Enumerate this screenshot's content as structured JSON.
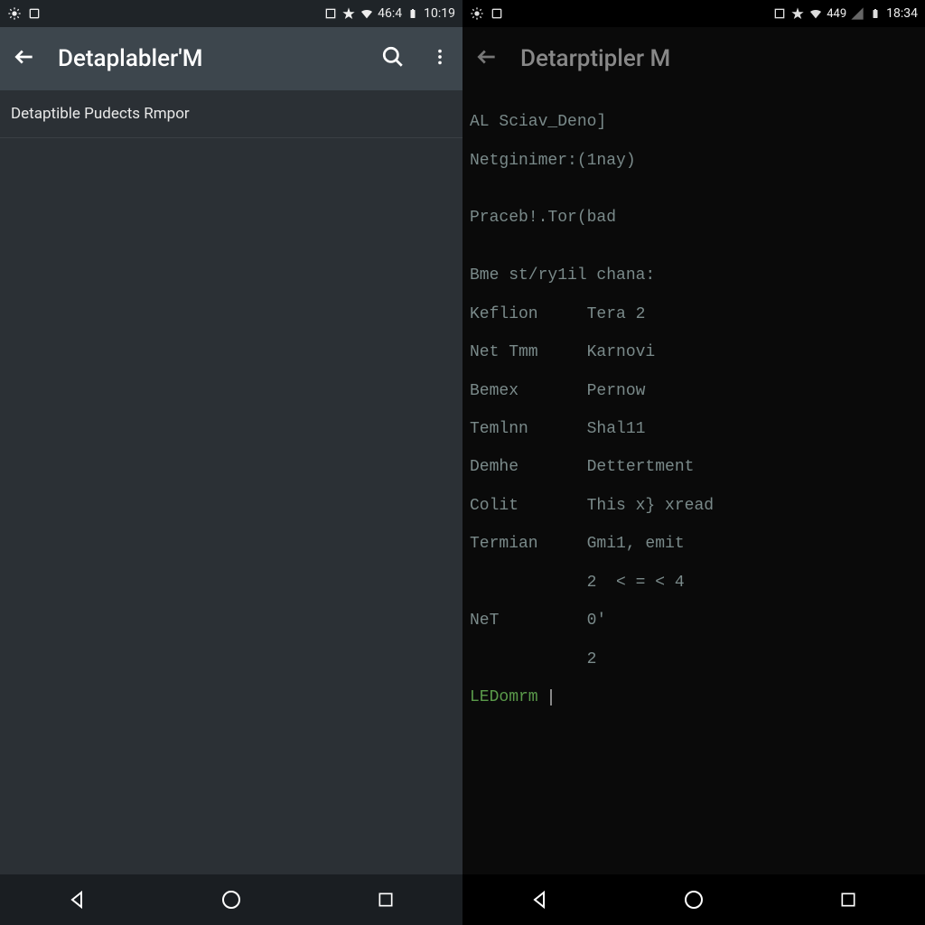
{
  "left": {
    "status": {
      "battery_percent": "46:4",
      "time": "10:19"
    },
    "appbar": {
      "title": "Detaplabler'M"
    },
    "list": {
      "item0": "Detaptible Pudects Rmpor"
    }
  },
  "right": {
    "status": {
      "battery_percent": "449",
      "time": "18:34"
    },
    "appbar": {
      "title": "Detarptipler M"
    },
    "terminal": {
      "line0": "AL Sciav_Deno]",
      "line1": "Netginimer:(1nay)",
      "line2": "",
      "line3": "Praceb!.Tor(bad",
      "line4": "",
      "line5": "Bme st/ry1il chana:",
      "line6": "Keflion     Tera 2",
      "line7": "Net Tmm     Karnovi",
      "line8": "Bemex       Pernow",
      "line9": "Temlnn      Shal11",
      "line10": "Demhe       Dettertment",
      "line11": "Colit       This x} xread",
      "line12": "Termian     Gmi1, emit",
      "line13": "            2  < = < 4",
      "line14": "NeT         0'",
      "line15": "            2",
      "prompt": "LEDomrm "
    }
  }
}
